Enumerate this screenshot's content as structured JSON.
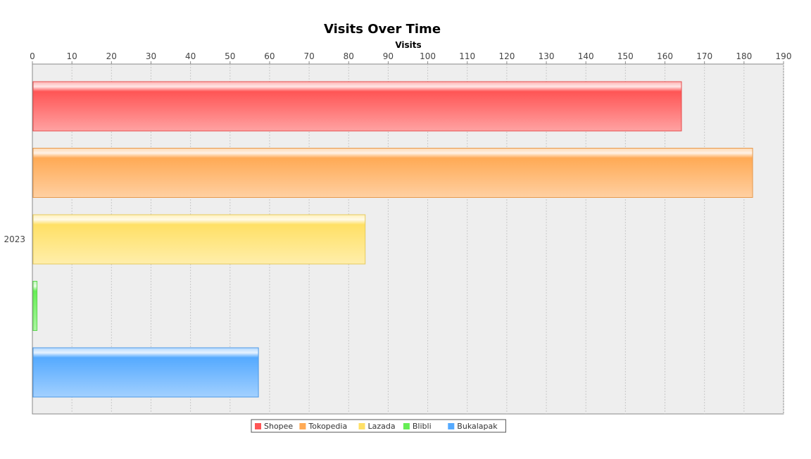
{
  "chart_data": {
    "type": "bar",
    "orientation": "horizontal",
    "title": "Visits Over Time",
    "xlabel": "Visits",
    "ylabel": "",
    "xlim": [
      0,
      190
    ],
    "x_ticks": [
      0,
      10,
      20,
      30,
      40,
      50,
      60,
      70,
      80,
      90,
      100,
      110,
      120,
      130,
      140,
      150,
      160,
      170,
      180,
      190
    ],
    "x_axis_position": "top",
    "categories": [
      "2023"
    ],
    "series": [
      {
        "name": "Shopee",
        "values": [
          164
        ],
        "color": "#ff5555"
      },
      {
        "name": "Tokopedia",
        "values": [
          182
        ],
        "color": "#ffaa55"
      },
      {
        "name": "Lazada",
        "values": [
          84
        ],
        "color": "#ffe066"
      },
      {
        "name": "Blibli",
        "values": [
          1
        ],
        "color": "#66ee55"
      },
      {
        "name": "Bukalapak",
        "values": [
          57
        ],
        "color": "#55aaff"
      }
    ],
    "grid": true,
    "legend": "bottom-center",
    "background": "#eeeeee"
  }
}
